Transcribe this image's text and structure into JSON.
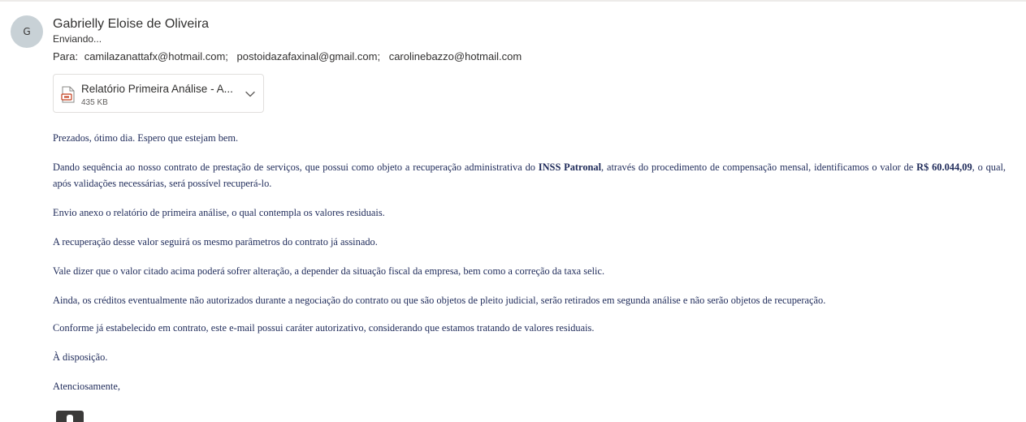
{
  "header": {
    "avatar_initial": "G",
    "sender_name": "Gabrielly Eloise de Oliveira",
    "status": "Enviando...",
    "to_label": "Para:",
    "recipients": [
      "camilazanattafx@hotmail.com;",
      "postoidazafaxinal@gmail.com;",
      "carolinebazzo@hotmail.com"
    ]
  },
  "attachment": {
    "name": "Relatório Primeira Análise - A...",
    "size": "435 KB",
    "icon": "pdf-file-icon",
    "accent_color": "#c43e1c"
  },
  "body": {
    "greeting": "Prezados, ótimo dia. Espero que estejam bem.",
    "p2_part1": "Dando sequência ao nosso contrato de prestação de serviços, que possui como objeto a recuperação administrativa do ",
    "p2_bold1": "INSS Patronal",
    "p2_part2": ", através do procedimento de compensação mensal, identificamos o valor de ",
    "p2_bold2": "R$ 60.044,09",
    "p2_part3": ", o qual, após validações necessárias, será possível recuperá-lo.",
    "p3": "Envio anexo o relatório de primeira análise, o qual contempla os valores residuais.",
    "p4": "A recuperação desse valor seguirá os mesmo parâmetros do contrato já assinado.",
    "p5": "Vale dizer que o valor citado acima poderá sofrer alteração, a depender da situação fiscal da empresa, bem como a correção da taxa selic.",
    "p6": "Ainda, os créditos eventualmente não autorizados durante a negociação do contrato ou que são objetos de pleito judicial, serão retirados em segunda análise e não serão objetos de recuperação.",
    "p7": "Conforme já estabelecido em contrato, este e-mail possui caráter autorizativo, considerando que estamos tratando de valores residuais.",
    "p8": "À disposição.",
    "closing": "Atenciosamente,"
  },
  "colors": {
    "body_text": "#1f2b5a",
    "avatar_bg": "#c8d1d6",
    "border": "#e1dfdd"
  }
}
